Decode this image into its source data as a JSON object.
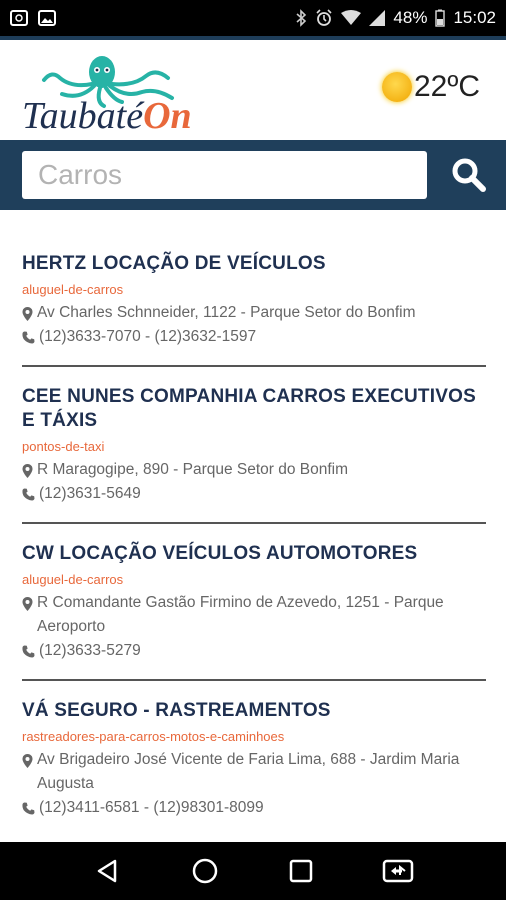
{
  "status_bar": {
    "battery": "48%",
    "time": "15:02",
    "icons": [
      "app-notification-icon",
      "image-notification-icon",
      "bluetooth-icon",
      "alarm-icon",
      "wifi-icon",
      "signal-icon",
      "battery-icon"
    ]
  },
  "header": {
    "logo_text_dark": "Taubaté",
    "logo_text_accent": "On",
    "temperature": "22ºC",
    "colors": {
      "brand_dark": "#1f3f5b",
      "accent": "#e8683b",
      "octopus": "#27b3a6"
    }
  },
  "search": {
    "placeholder": "Carros",
    "value": ""
  },
  "results": [
    {
      "title": "HERTZ LOCAÇÃO DE VEÍCULOS",
      "category": "aluguel-de-carros",
      "address": "Av Charles Schnneider, 1122 - Parque Setor do Bonfim",
      "phone": "(12)3633-7070 - (12)3632-1597"
    },
    {
      "title": "CEE NUNES COMPANHIA CARROS EXECUTIVOS E TÁXIS",
      "category": "pontos-de-taxi",
      "address": "R Maragogipe, 890 - Parque Setor do Bonfim",
      "phone": "(12)3631-5649"
    },
    {
      "title": "CW LOCAÇÃO VEÍCULOS AUTOMOTORES",
      "category": "aluguel-de-carros",
      "address": "R Comandante Gastão Firmino de Azevedo, 1251 - Parque Aeroporto",
      "phone": "(12)3633-5279"
    },
    {
      "title": "VÁ SEGURO - RASTREAMENTOS",
      "category": "rastreadores-para-carros-motos-e-caminhoes",
      "address": "Av Brigadeiro José Vicente de Faria Lima, 688 - Jardim Maria Augusta",
      "phone": "(12)3411-6581 - (12)98301-8099"
    }
  ],
  "nav_bar": {
    "icons": [
      "back-icon",
      "home-icon",
      "recents-icon",
      "screen-mirror-icon"
    ]
  }
}
